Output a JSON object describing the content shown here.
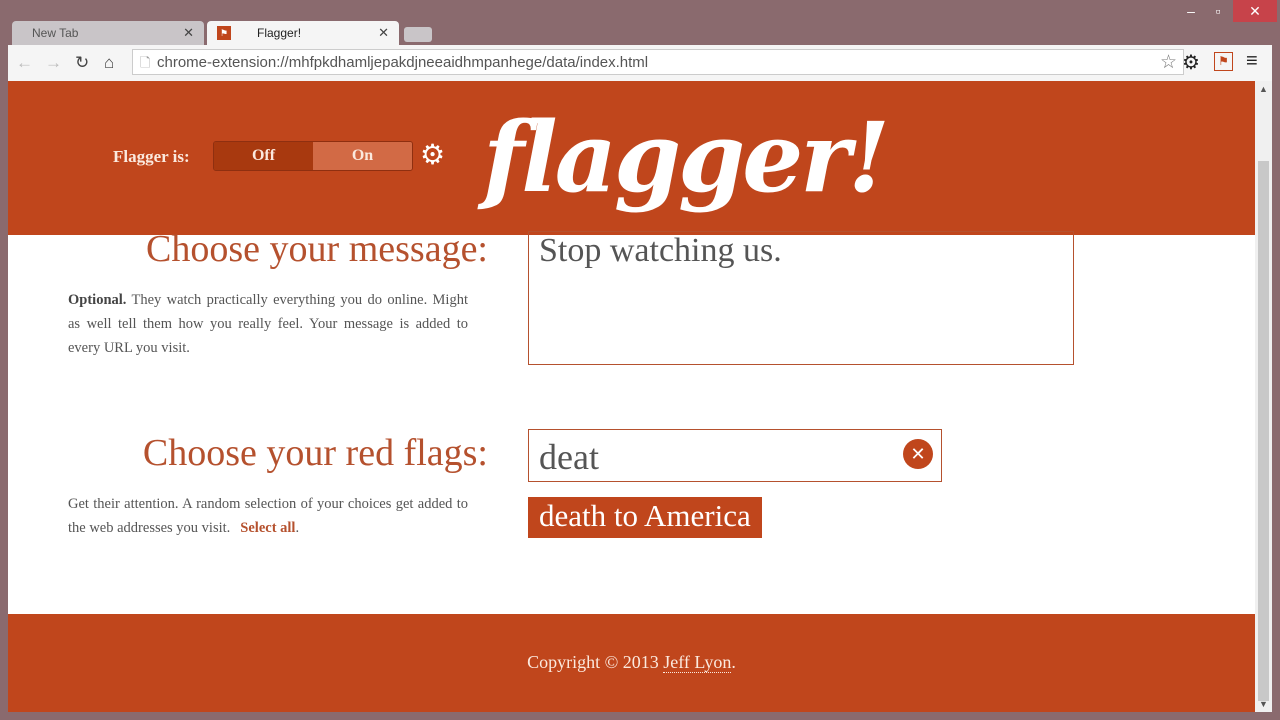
{
  "browser": {
    "tabs": [
      {
        "label": "New Tab"
      },
      {
        "label": "Flagger!",
        "favicon": "flag-icon"
      }
    ],
    "url": "chrome-extension://mhfpkdhamljepakdjneeaidhmpanhege/data/index.html"
  },
  "header": {
    "status_label": "Flagger is:",
    "toggle": {
      "off": "Off",
      "on": "On",
      "selected": "Off"
    },
    "logo": "flagger!"
  },
  "message": {
    "heading": "Choose your message:",
    "desc_bold": "Optional.",
    "desc": " They watch practically everything you do online. Might as well tell them how you really feel. Your message is added to every URL you visit.",
    "value": "Stop watching us."
  },
  "flags": {
    "heading": "Choose your red flags:",
    "desc": "Get their attention. A random selection of your choices get added to the web addresses you visit.",
    "select_all": "Select all",
    "input_value": "deat",
    "suggestions": [
      "death to America"
    ]
  },
  "footer": {
    "prefix": "Copyright © 2013 ",
    "author": "Jeff Lyon",
    "suffix": "."
  },
  "colors": {
    "brand": "#c0461c",
    "heading": "#b5512e"
  }
}
